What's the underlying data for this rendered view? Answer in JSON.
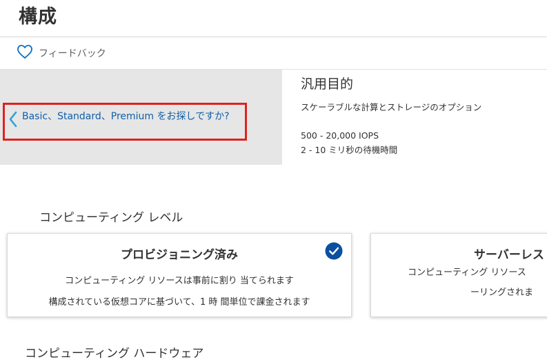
{
  "page": {
    "title": "構成"
  },
  "feedback": {
    "label": "フィードバック",
    "icon": "heart-icon"
  },
  "left_panel": {
    "back_link_text": "Basic、Standard、Premium をお探しですか?",
    "back_icon": "chevron-left-icon"
  },
  "plan": {
    "title": "汎用目的",
    "description": "スケーラブルな計算とストレージのオプション",
    "iops": "500 - 20,000 IOPS",
    "latency": "2 - 10 ミリ秒の待機時間"
  },
  "compute_tier": {
    "section_label": "コンピューティング レベル",
    "options": [
      {
        "title": "プロビジョニング済み",
        "line1": "コンピューティング リソースは事前に割り 当てられます",
        "line2": "構成されている仮想コアに基づいて、1 時  間単位で課金されます",
        "selected": true
      },
      {
        "title": "サーバーレス",
        "line1": "コンピューティング リソース",
        "line2": "ーリングされま",
        "selected": false
      }
    ]
  },
  "hardware": {
    "section_label": "コンピューティング ハードウェア"
  },
  "colors": {
    "accent": "#0f5ea8",
    "check": "#0b4fa1",
    "highlight_border": "#e02020",
    "panel_bg": "#e6e6e6"
  }
}
